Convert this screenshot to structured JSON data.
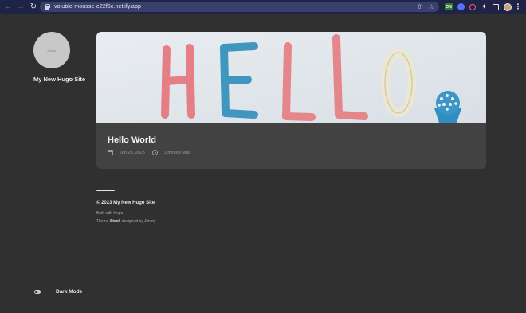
{
  "browser": {
    "url": "voluble-mousse-e22f5c.netlify.app",
    "extension_badge": "ON"
  },
  "sidebar": {
    "avatar_alt": "Avatar",
    "site_name": "My New Hugo Site",
    "dark_mode_label": "Dark Mode"
  },
  "article": {
    "image_text": "HELLO",
    "title": "Hello World",
    "date": "Jun 28, 2023",
    "reading_time": "1 minute read"
  },
  "footer": {
    "copyright": "© 2023 My New Hugo Site",
    "built_with": "Built with Hugo",
    "theme_prefix": "Theme",
    "theme_name": "Stack",
    "theme_suffix": "designed by Jimmy"
  },
  "colors": {
    "page_bg": "#303030",
    "card_bg": "#424242",
    "browser_bar": "#1f2447"
  }
}
